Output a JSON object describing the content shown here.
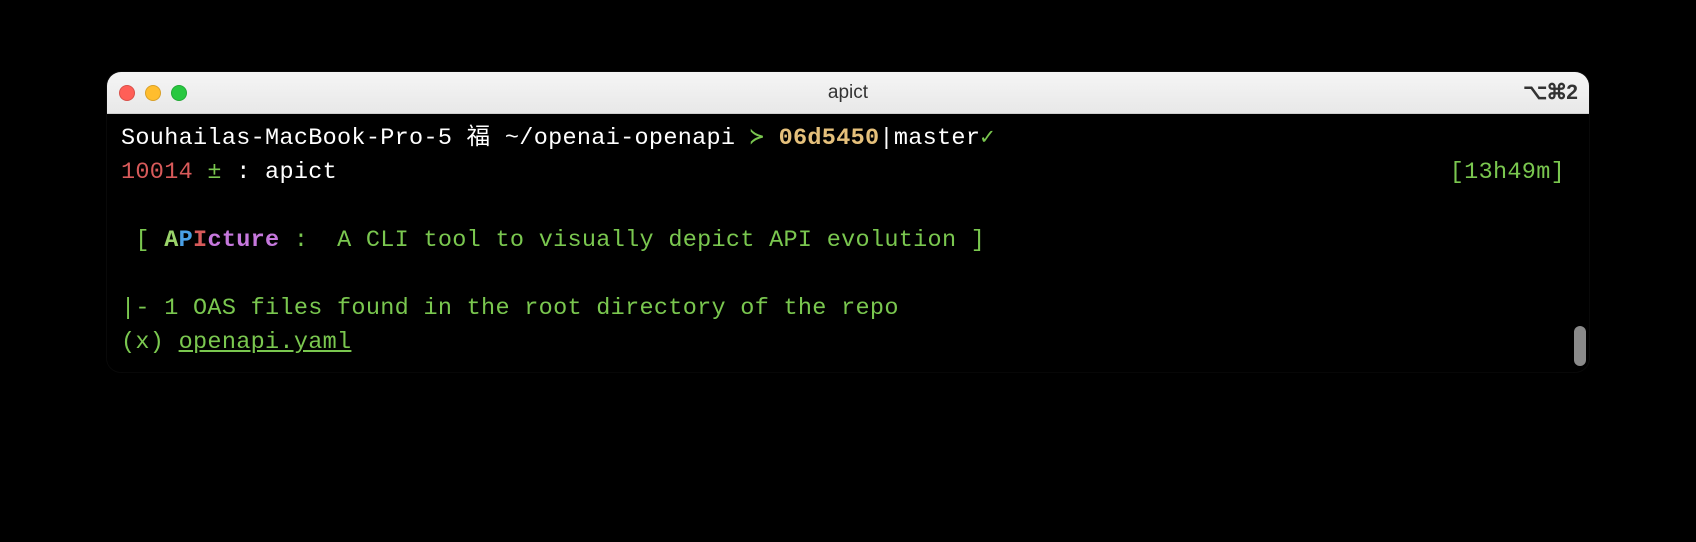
{
  "window": {
    "title": "apict",
    "shortcut": "⌥⌘2",
    "traffic": {
      "red": "#ff5f57",
      "yellow": "#ffbd2e",
      "green": "#28c840"
    }
  },
  "prompt": {
    "hostname": "Souhailas-MacBook-Pro-5",
    "symbol": "福",
    "path": "~/openai-openapi",
    "separator": "≻",
    "commit": "06d5450",
    "branch": "master",
    "check": "✓",
    "history_num": "10014",
    "git_marker": "±",
    "colon": ":",
    "command": "apict",
    "timestamp": "[13h49m]"
  },
  "banner": {
    "open": " [ ",
    "A": "A",
    "P": "P",
    "I": "I",
    "cture": "cture",
    "sep": " :  ",
    "tagline": "A CLI tool to visually depict API evolution",
    "close": " ]"
  },
  "output": {
    "files_line": "|- 1 OAS files found in the root directory of the repo",
    "selector": "(x) ",
    "filename": "openapi.yaml"
  }
}
